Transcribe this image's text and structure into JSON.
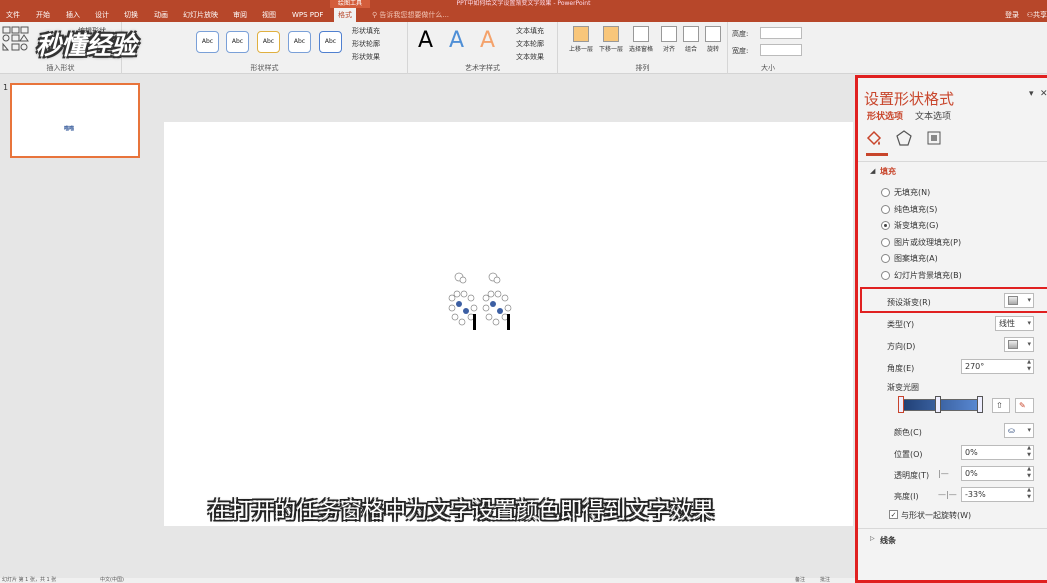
{
  "titlebar": {
    "context_tab": "绘图工具",
    "title": "PPT中如何给文字设置渐变文字效果 - PowerPoint"
  },
  "tabs": [
    "文件",
    "开始",
    "插入",
    "设计",
    "切换",
    "动画",
    "幻灯片放映",
    "审阅",
    "视图",
    "WPS PDF",
    "格式"
  ],
  "active_tab": "格式",
  "tellme": "告诉我您想要做什么...",
  "login": "登录",
  "share": "共享",
  "ribbon": {
    "group_insert_shapes": "插入形状",
    "group_shape_styles": "形状样式",
    "group_wordart": "艺术字样式",
    "group_arrange": "排列",
    "group_size": "大小",
    "edit_shape": "编辑形状",
    "abc": [
      "Abc",
      "Abc",
      "Abc",
      "Abc",
      "Abc",
      "Abc"
    ],
    "shape_fill": "形状填充",
    "shape_outline": "形状轮廓",
    "shape_effects": "形状效果",
    "wordart_letters": [
      "A",
      "A",
      "A"
    ],
    "text_fill": "文本填充",
    "text_outline": "文本轮廓",
    "text_effects": "文本效果",
    "arrange": [
      "上移一层",
      "下移一层",
      "选择窗格",
      "对齐",
      "组合",
      "旋转"
    ],
    "height_label": "高度:",
    "width_label": "宽度:"
  },
  "watermark": "秒懂经验",
  "thumbnail": {
    "number": "1",
    "text": "喵喵"
  },
  "subtitle": "在打开的任务窗格中为文字设置颜色即得到文字效果",
  "pane": {
    "title": "设置形状格式",
    "tab_shape": "形状选项",
    "tab_text": "文本选项",
    "pin": "▾",
    "close": "✕",
    "fill_section": "填充",
    "fill_options": [
      "无填充(N)",
      "纯色填充(S)",
      "渐变填充(G)",
      "图片或纹理填充(P)",
      "图案填充(A)",
      "幻灯片背景填充(B)"
    ],
    "selected_fill": 2,
    "preset_label": "预设渐变(R)",
    "type_label": "类型(Y)",
    "type_value": "线性",
    "direction_label": "方向(D)",
    "angle_label": "角度(E)",
    "angle_value": "270°",
    "stops_label": "渐变光圈",
    "color_label": "颜色(C)",
    "position_label": "位置(O)",
    "position_value": "0%",
    "transparency_label": "透明度(T)",
    "transparency_value": "0%",
    "brightness_label": "亮度(I)",
    "brightness_value": "-33%",
    "rotate_label": "与形状一起旋转(W)",
    "rotate_checked": true,
    "line_section": "线条"
  },
  "status": {
    "slide": "幻灯片 第 1 张，共 1 张",
    "lang": "中文(中国)",
    "notes": "备注",
    "comments": "批注"
  },
  "colors": {
    "accent": "#b7472a",
    "highlight": "#e02020",
    "gradient_start": "#1f3e73",
    "gradient_end": "#5b8bd6"
  }
}
